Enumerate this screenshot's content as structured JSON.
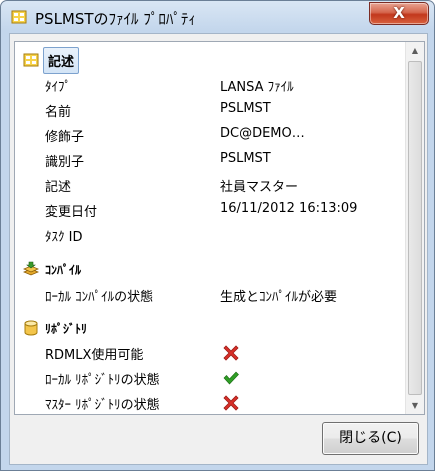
{
  "window": {
    "title": "PSLMSTのﾌｧｲﾙ ﾌﾟﾛﾊﾟﾃｨ",
    "close_glyph": "X"
  },
  "sections": {
    "description": {
      "label": "記述",
      "rows": [
        {
          "key": "ﾀｲﾌﾟ",
          "value": "LANSA ﾌｧｲﾙ"
        },
        {
          "key": "名前",
          "value": "PSLMST"
        },
        {
          "key": "修飾子",
          "value": "DC@DEMO…"
        },
        {
          "key": "識別子",
          "value": "PSLMST"
        },
        {
          "key": "記述",
          "value": "社員マスター"
        },
        {
          "key": "変更日付",
          "value": "16/11/2012 16:13:09"
        },
        {
          "key": "ﾀｽｸ ID",
          "value": ""
        }
      ]
    },
    "compile": {
      "label": "ｺﾝﾊﾟｲﾙ",
      "rows": [
        {
          "key": "ﾛｰｶﾙ ｺﾝﾊﾟｲﾙの状態",
          "value": "生成とｺﾝﾊﾟｲﾙが必要"
        }
      ]
    },
    "repository": {
      "label": "ﾘﾎﾟｼﾞﾄﾘ",
      "rows": [
        {
          "key": "RDMLX使用可能",
          "icon": "red-x-icon"
        },
        {
          "key": "ﾛｰｶﾙ ﾘﾎﾟｼﾞﾄﾘの状態",
          "icon": "green-check-icon"
        },
        {
          "key": "ﾏｽﾀｰ ﾘﾎﾟｼﾞﾄﾘの状態",
          "icon": "red-x-icon"
        }
      ]
    }
  },
  "buttons": {
    "close_label": "閉じる(C)"
  },
  "colors": {
    "accent_red": "#d8302a",
    "accent_green": "#2f9e26",
    "title_gradient_top": "#d9e6f4"
  }
}
